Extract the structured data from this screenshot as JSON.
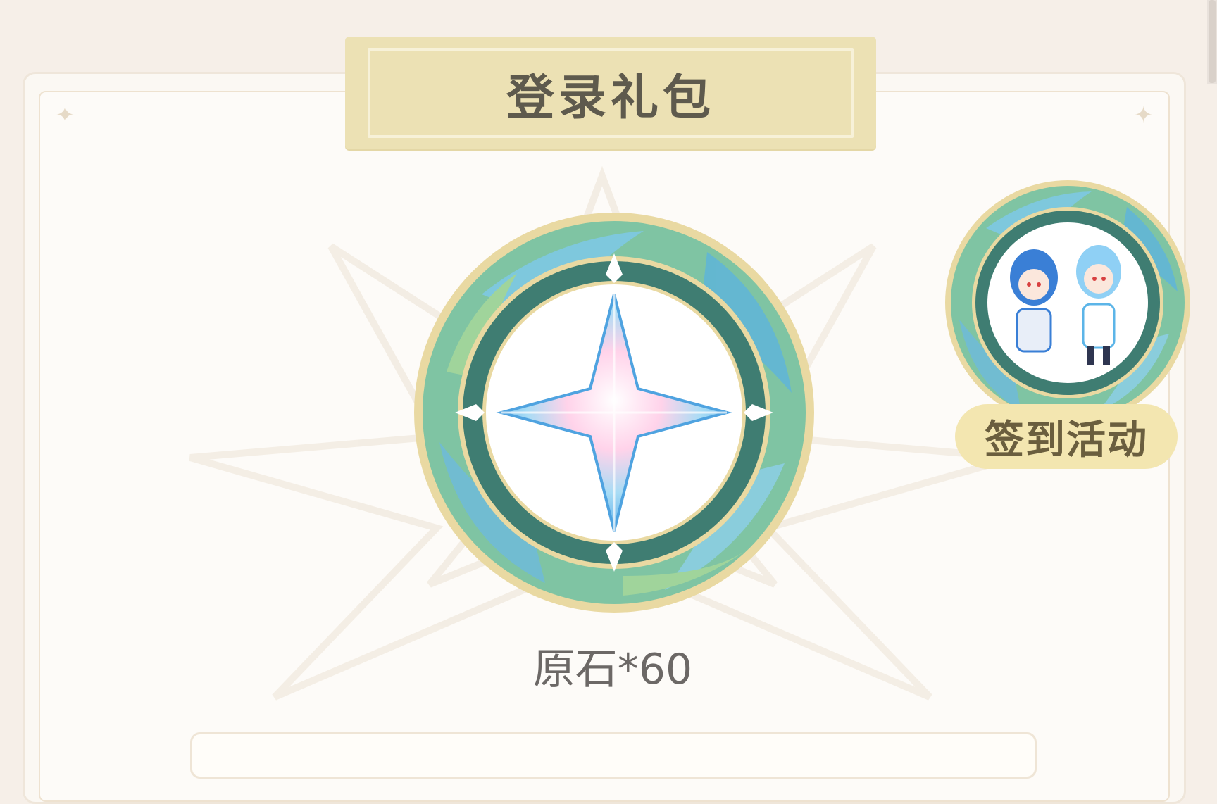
{
  "header": {
    "title": "登录礼包"
  },
  "reward": {
    "item_icon": "primogem-icon",
    "label": "原石*60"
  },
  "checkin": {
    "label": "签到活动",
    "icon": "chibi-characters-icon"
  },
  "colors": {
    "background": "#f6efe8",
    "banner": "#ece1b4",
    "medal_ring": "#3f7d72",
    "medal_gold": "#e6d49a",
    "label_pill": "#f3e6b0"
  }
}
